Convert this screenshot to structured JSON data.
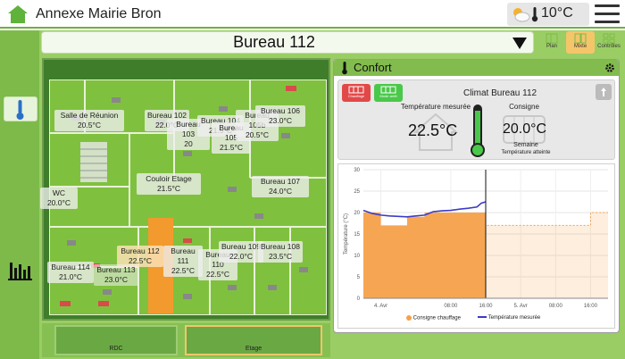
{
  "app": {
    "title": "Annexe Mairie Bron"
  },
  "weather": {
    "temperature": "10°C",
    "icon": "partly-cloudy-icon"
  },
  "header": {
    "room_title": "Bureau 112"
  },
  "view_tabs": [
    {
      "label": "Plan",
      "active": false
    },
    {
      "label": "Mixte",
      "active": true
    },
    {
      "label": "Contrôles",
      "active": false
    }
  ],
  "floorplan": {
    "rooms": [
      {
        "name": "Salle de Réunion",
        "temp": "20.5°C"
      },
      {
        "name": "Bureau 102",
        "temp": "22.0°C"
      },
      {
        "name": "Bureau 103",
        "temp": "20"
      },
      {
        "name": "Bureau 104",
        "temp": "21.5°C"
      },
      {
        "name": "Bureau 105",
        "temp": "21.5°C"
      },
      {
        "name": "Bureau 105b",
        "temp": "20.5°C"
      },
      {
        "name": "Bureau 106",
        "temp": "23.0°C"
      },
      {
        "name": "Couloir Etage",
        "temp": "21.5°C"
      },
      {
        "name": "Bureau 107",
        "temp": "24.0°C"
      },
      {
        "name": "WC",
        "temp": "20.0°C"
      },
      {
        "name": "Bureau 112",
        "temp": "22.5°C"
      },
      {
        "name": "Bureau 111",
        "temp": "22.5°C"
      },
      {
        "name": "Bureau 110",
        "temp": "22.5°C"
      },
      {
        "name": "Bureau 109",
        "temp": "22.0°C"
      },
      {
        "name": "Bureau 108",
        "temp": "23.5°C"
      },
      {
        "name": "Bureau 114",
        "temp": "21.0°C"
      },
      {
        "name": "Bureau 113",
        "temp": "23.0°C"
      }
    ],
    "floors": [
      {
        "label": "RDC",
        "active": false
      },
      {
        "label": "Etage",
        "active": true
      }
    ]
  },
  "panel": {
    "title": "Confort",
    "climate_name": "Climat Bureau 112",
    "mode_heat_label": "Chauffage",
    "mode_off_label": "Mode arrêt",
    "measured_label": "Température mesurée",
    "measured_value": "22.5°C",
    "setpoint_label": "Consigne",
    "setpoint_value": "20.0°C",
    "setpoint_mode": "Semaine",
    "setpoint_note": "Température atteinte"
  },
  "chart_data": {
    "type": "line",
    "ylabel": "Température (°C)",
    "ylim": [
      0,
      30
    ],
    "yticks": [
      0,
      5,
      10,
      15,
      20,
      25,
      30
    ],
    "x_ticks": [
      "4. Avr",
      "08:00",
      "16:00",
      "5. Avr",
      "08:00",
      "16:00"
    ],
    "x_hours": [
      0,
      4,
      20,
      28,
      36,
      44,
      52,
      56
    ],
    "now_hour": 28,
    "series": [
      {
        "name": "Consigne chauffage",
        "color": "#f5a14a",
        "x": [
          0,
          4,
          4,
          10,
          10,
          14,
          14,
          28,
          28,
          36,
          36,
          52,
          52,
          56
        ],
        "values": [
          20,
          20,
          17,
          17,
          19,
          19,
          20,
          20,
          17,
          17,
          17,
          17,
          20,
          20
        ]
      },
      {
        "name": "Température mesurée",
        "color": "#3b3bc8",
        "x": [
          0,
          2,
          4,
          6,
          8,
          10,
          12,
          14,
          16,
          18,
          20,
          22,
          24,
          26,
          27,
          28
        ],
        "values": [
          20.5,
          19.8,
          19.4,
          19.2,
          19.1,
          19.0,
          19.2,
          19.4,
          20.2,
          20.4,
          20.5,
          20.8,
          21.0,
          21.3,
          22.2,
          22.5
        ]
      }
    ],
    "legend": [
      "Consigne chauffage",
      "Température mesurée"
    ]
  }
}
